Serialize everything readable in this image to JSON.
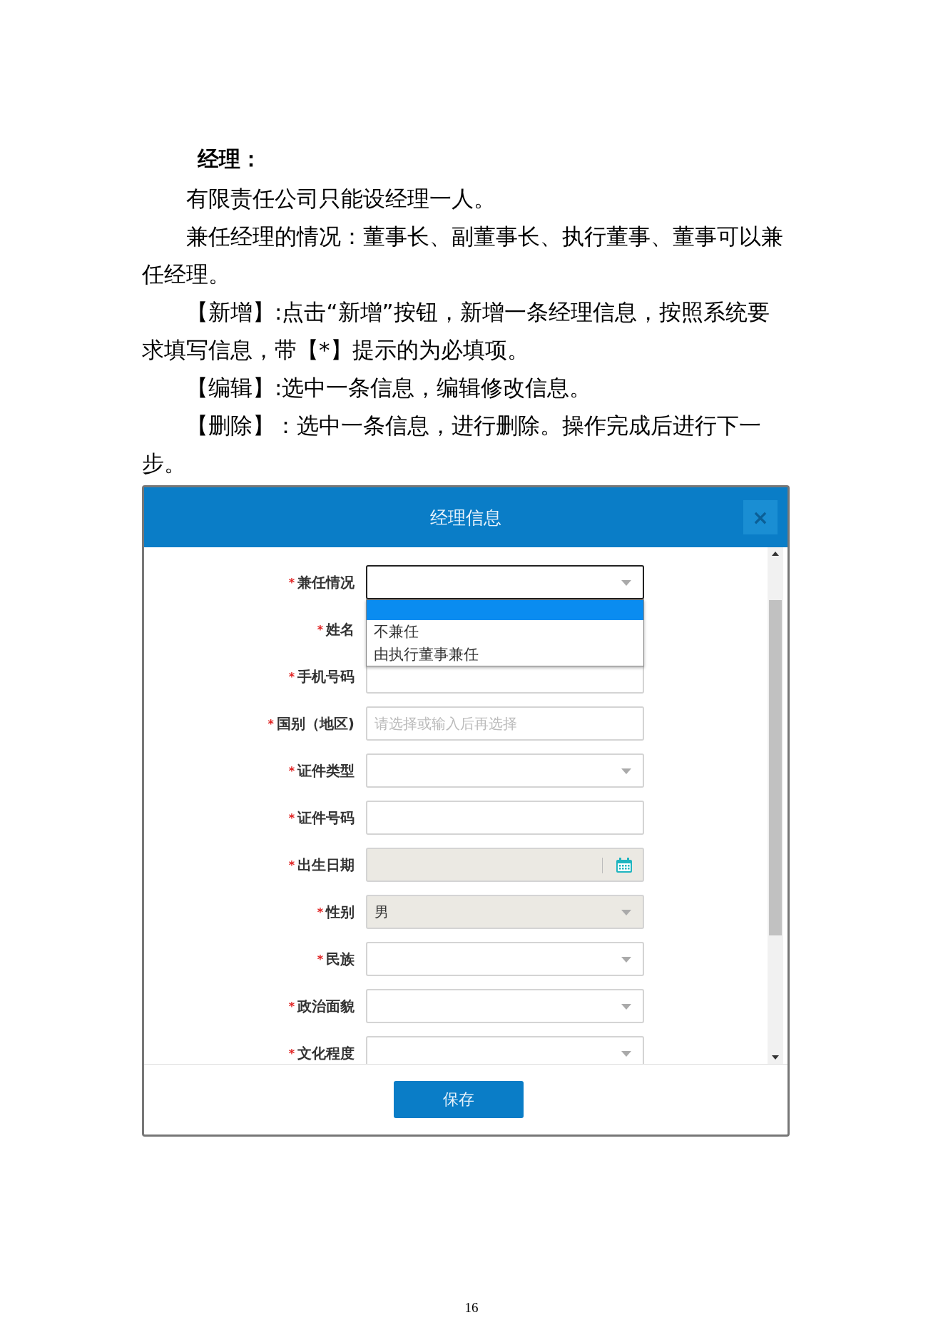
{
  "document": {
    "heading": "经理：",
    "paragraphs": [
      {
        "text": "有限责任公司只能设经理一人。"
      },
      {
        "text": "兼任经理的情况：董事长、副董事长、执行董事、董事可以兼任经理。"
      },
      {
        "text": "【新增】:点击“新增”按钮，新增一条经理信息，按照系统要求填写信息，带【*】提示的为必填项。"
      },
      {
        "text": "【编辑】:选中一条信息，编辑修改信息。"
      },
      {
        "text": "【删除】：选中一条信息，进行删除。操作完成后进行下一步。"
      }
    ]
  },
  "dialog": {
    "title": "经理信息",
    "close": "×",
    "fields": [
      {
        "label": "兼任情况",
        "required_mark": "*",
        "kind": "select",
        "focused": true,
        "disabled": false
      },
      {
        "label": "姓名",
        "required_mark": "*",
        "kind": "covered"
      },
      {
        "label": "手机号码",
        "required_mark": "*",
        "kind": "text",
        "focused": false,
        "disabled": false
      },
      {
        "label": "国别（地区)",
        "required_mark": "*",
        "kind": "text",
        "placeholder": "请选择或输入后再选择",
        "focused": false,
        "disabled": false
      },
      {
        "label": "证件类型",
        "required_mark": "*",
        "kind": "select",
        "focused": false,
        "disabled": false
      },
      {
        "label": "证件号码",
        "required_mark": "*",
        "kind": "text",
        "focused": false,
        "disabled": false
      },
      {
        "label": "出生日期",
        "required_mark": "*",
        "kind": "date",
        "focused": false,
        "disabled": true
      },
      {
        "label": "性别",
        "required_mark": "*",
        "kind": "select",
        "value": "男",
        "focused": false,
        "disabled": true
      },
      {
        "label": "民族",
        "required_mark": "*",
        "kind": "select",
        "focused": false,
        "disabled": false
      },
      {
        "label": "政治面貌",
        "required_mark": "*",
        "kind": "select",
        "focused": false,
        "disabled": false
      },
      {
        "label": "文化程度",
        "required_mark": "*",
        "kind": "select",
        "focused": false,
        "disabled": false
      }
    ],
    "dropdown": {
      "blank_option_highlighted": true,
      "options": [
        {
          "label": "不兼任",
          "selected": false
        },
        {
          "label": "由执行董事兼任",
          "selected": false
        }
      ]
    },
    "save_button": "保存"
  },
  "page_number": "16"
}
